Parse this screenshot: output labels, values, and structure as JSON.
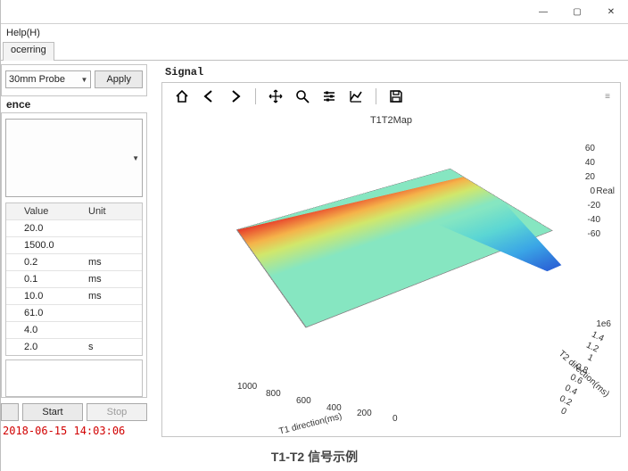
{
  "window_controls": {
    "min": "—",
    "max": "▢",
    "close": "✕"
  },
  "menubar": {
    "help": "Help(H)"
  },
  "tabs": {
    "active": "ocerring"
  },
  "probe": {
    "selected": "30mm Probe",
    "apply": "Apply"
  },
  "sequence": {
    "label": "ence",
    "dropdown": ""
  },
  "params_table": {
    "headers": {
      "value": "Value",
      "unit": "Unit"
    },
    "rows": [
      {
        "value": "20.0",
        "unit": ""
      },
      {
        "value": "1500.0",
        "unit": ""
      },
      {
        "value": "0.2",
        "unit": "ms"
      },
      {
        "value": "0.1",
        "unit": "ms"
      },
      {
        "value": "10.0",
        "unit": "ms"
      },
      {
        "value": "61.0",
        "unit": ""
      },
      {
        "value": "4.0",
        "unit": ""
      },
      {
        "value": "2.0",
        "unit": "s"
      }
    ]
  },
  "buttons": {
    "start": "Start",
    "stop": "Stop"
  },
  "timestamp": "2018-06-15 14:03:06",
  "signal": {
    "label": "Signal",
    "toolbar": {
      "home": "⌂",
      "back": "←",
      "forward": "→",
      "pan": "✥",
      "zoom": "🔍",
      "config": "⚙",
      "axes": "📈",
      "save": "💾"
    }
  },
  "chart_data": {
    "type": "surface3d",
    "title": "T1T2Map",
    "xlabel": "T1 direction(ms)",
    "ylabel": "T2 direction(ms)",
    "zlabel": "Real",
    "x_ticks": [
      0,
      200,
      400,
      600,
      800,
      1000
    ],
    "y_ticks": [
      0.0,
      0.2,
      0.4,
      0.6,
      0.8,
      1.0,
      1.2,
      1.4
    ],
    "y_scale": "1e6",
    "z_ticks": [
      -60,
      -40,
      -20,
      0,
      20,
      40,
      60
    ],
    "description": "Surface rises smoothly to ~60 along low-T1 edge (red ridge), flattens near 0 across most of the T1–T2 plane (green plateau), and dips sharply to ~-60 near T1≈0, T2≈1.4e6 (blue trough)."
  },
  "caption": "T1-T2 信号示例"
}
